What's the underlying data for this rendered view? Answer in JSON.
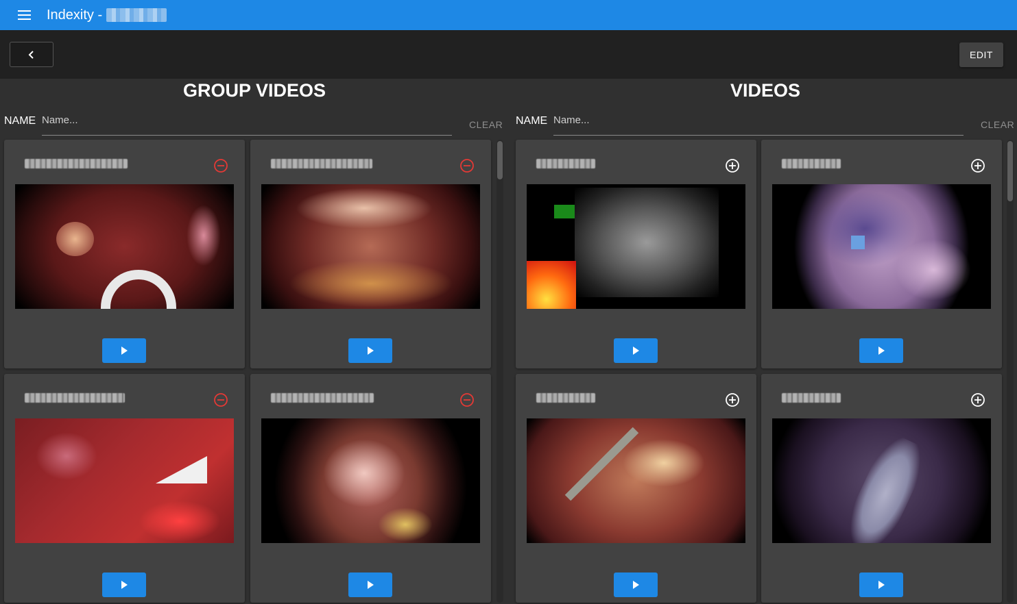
{
  "app": {
    "title": "Indexity - ",
    "back_icon": "chevron-left-icon",
    "menu_icon": "menu-icon",
    "edit_label": "EDIT",
    "accent_color": "#1e88e5",
    "remove_color": "#e53935"
  },
  "group_videos": {
    "title": "GROUP VIDEOS",
    "search": {
      "label": "NAME",
      "placeholder": "Name...",
      "clear_label": "CLEAR"
    },
    "action_icon": "minus-circle-icon",
    "cards": [
      {
        "thumb": "surgery-red-with-white-tool"
      },
      {
        "thumb": "surgery-tissue-dark"
      },
      {
        "thumb": "surgery-bloody-with-white-tool"
      },
      {
        "thumb": "surgery-orange-tissue"
      }
    ]
  },
  "videos": {
    "title": "VIDEOS",
    "search": {
      "label": "NAME",
      "placeholder": "Name...",
      "clear_label": "CLEAR"
    },
    "action_icon": "plus-circle-icon",
    "cards": [
      {
        "thumb": "grayscale-noise-with-heat-inset"
      },
      {
        "thumb": "purple-tissue-circle"
      },
      {
        "thumb": "surgery-with-probe"
      },
      {
        "thumb": "dark-purple-tissue"
      }
    ]
  },
  "play_icon": "play-icon"
}
